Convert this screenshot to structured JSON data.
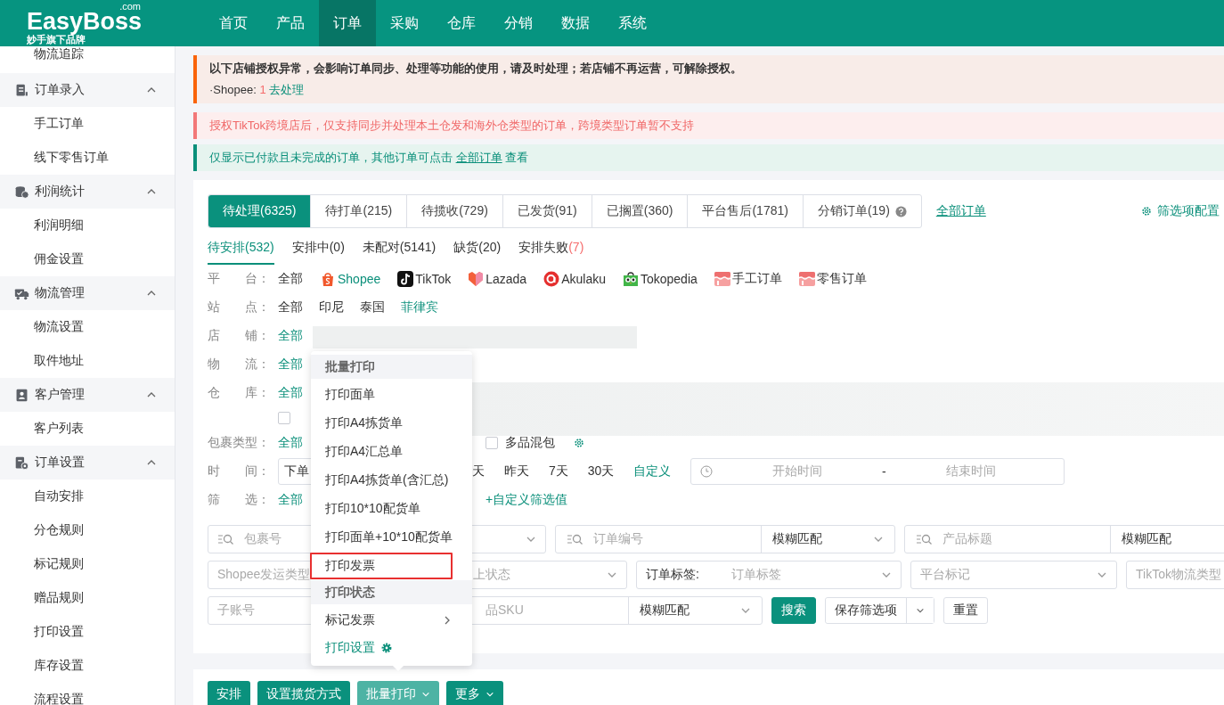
{
  "header": {
    "logo": {
      "name": "EasyBoss",
      "domain": ".com",
      "tagline": "妙手旗下品牌"
    },
    "nav": [
      {
        "label": "首页",
        "selected": false
      },
      {
        "label": "产品",
        "selected": false
      },
      {
        "label": "订单",
        "selected": true
      },
      {
        "label": "采购",
        "selected": false
      },
      {
        "label": "仓库",
        "selected": false
      },
      {
        "label": "分销",
        "selected": false
      },
      {
        "label": "数据",
        "selected": false
      },
      {
        "label": "系统",
        "selected": false
      }
    ]
  },
  "sidebar": {
    "items": [
      {
        "kind": "item",
        "label": "物流追踪"
      },
      {
        "kind": "group",
        "label": "订单录入",
        "expanded": true,
        "children": [
          {
            "label": "手工订单"
          },
          {
            "label": "线下零售订单"
          }
        ]
      },
      {
        "kind": "group",
        "label": "利润统计",
        "expanded": true,
        "children": [
          {
            "label": "利润明细"
          },
          {
            "label": "佣金设置"
          }
        ]
      },
      {
        "kind": "group",
        "label": "物流管理",
        "expanded": true,
        "children": [
          {
            "label": "物流设置"
          },
          {
            "label": "取件地址"
          }
        ]
      },
      {
        "kind": "group",
        "label": "客户管理",
        "expanded": true,
        "children": [
          {
            "label": "客户列表"
          }
        ]
      },
      {
        "kind": "group",
        "label": "订单设置",
        "expanded": true,
        "children": [
          {
            "label": "自动安排"
          },
          {
            "label": "分仓规则"
          },
          {
            "label": "标记规则"
          },
          {
            "label": "赠品规则"
          },
          {
            "label": "打印设置"
          },
          {
            "label": "库存设置"
          },
          {
            "label": "流程设置"
          }
        ]
      }
    ]
  },
  "alerts": [
    {
      "kind": "warning",
      "title": "以下店铺授权异常，会影响订单同步、处理等功能的使用，请及时处理；若店铺不再运营，可解除授权。",
      "platform": "·Shopee: ",
      "count": "1",
      "action": "去处理"
    },
    {
      "kind": "error",
      "text": "授权TikTok跨境店后，仅支持同步并处理本土仓发和海外仓类型的订单，跨境类型订单暂不支持"
    },
    {
      "kind": "info",
      "text": "仅显示已付款且未完成的订单，其他订单可点击 ",
      "link": "全部订单",
      "after": " 查看"
    }
  ],
  "tabs": [
    {
      "label": "待处理(6325)",
      "selected": true
    },
    {
      "label": "待打单(215)",
      "selected": false
    },
    {
      "label": "待揽收(729)",
      "selected": false
    },
    {
      "label": "已发货(91)",
      "selected": false
    },
    {
      "label": "已搁置(360)",
      "selected": false
    },
    {
      "label": "平台售后(1781)",
      "selected": false
    },
    {
      "label": "分销订单(19)",
      "selected": false,
      "help": true
    }
  ],
  "all_orders_link": "全部订单",
  "filter_config": "筛选项配置",
  "subtabs": [
    {
      "label": "待安排",
      "count": "(532)",
      "selected": true,
      "alert": false
    },
    {
      "label": "安排中",
      "count": "(0)",
      "selected": false,
      "alert": false
    },
    {
      "label": "未配对",
      "count": "(5141)",
      "selected": false,
      "alert": false
    },
    {
      "label": "缺货",
      "count": "(20)",
      "selected": false,
      "alert": false
    },
    {
      "label": "安排失败",
      "count": "(7)",
      "selected": false,
      "alert": true
    }
  ],
  "filters": [
    {
      "kind": "options",
      "label": "平　　台：",
      "options": [
        {
          "label": "全部",
          "selected": false
        },
        {
          "label": "Shopee",
          "selected": true,
          "kind": "shopee"
        },
        {
          "label": "TikTok",
          "selected": false,
          "kind": "tiktok"
        },
        {
          "label": "Lazada",
          "selected": false,
          "kind": "lazada"
        },
        {
          "label": "Akulaku",
          "selected": false,
          "kind": "akulaku"
        },
        {
          "label": "Tokopedia",
          "selected": false,
          "kind": "tokopedia"
        },
        {
          "label": "手工订单",
          "selected": false,
          "kind": "shop"
        },
        {
          "label": "零售订单",
          "selected": false,
          "kind": "shop"
        }
      ]
    },
    {
      "kind": "options",
      "label": "站　　点：",
      "options": [
        {
          "label": "全部",
          "selected": false
        },
        {
          "label": "印尼",
          "selected": false
        },
        {
          "label": "泰国",
          "selected": false
        },
        {
          "label": "菲律宾",
          "selected": true
        }
      ]
    },
    {
      "kind": "options",
      "label": "店　　铺：",
      "options": [
        {
          "label": "全部",
          "selected": true
        }
      ],
      "blurred": true
    },
    {
      "kind": "options",
      "label": "物　　流：",
      "options": [
        {
          "label": "全部",
          "selected": true
        }
      ]
    },
    {
      "kind": "options",
      "label": "仓　　库：",
      "options": [
        {
          "label": "全部",
          "selected": true
        }
      ],
      "blurred": true
    },
    {
      "kind": "checkbox",
      "checked": false
    },
    {
      "kind": "options",
      "label": "包裹类型：",
      "options": [
        {
          "label": "全部",
          "selected": true
        }
      ],
      "after": [
        {
          "kind": "checkbox",
          "label": "多品混包",
          "checked": false
        },
        {
          "kind": "gear"
        }
      ]
    },
    {
      "kind": "time",
      "label": "时　　间：",
      "select": "下单",
      "after": [
        {
          "kind": "option",
          "label": "天",
          "selected": false
        },
        {
          "kind": "option",
          "label": "昨天",
          "selected": false
        },
        {
          "kind": "option",
          "label": "7天",
          "selected": false
        },
        {
          "kind": "option",
          "label": "30天",
          "selected": false
        },
        {
          "kind": "option",
          "label": "自定义",
          "selected": true
        },
        {
          "kind": "range",
          "start": "开始时间",
          "separator": "-",
          "end": "结束时间"
        }
      ]
    },
    {
      "kind": "options",
      "label": "筛　　选：",
      "options": [
        {
          "label": "全部",
          "selected": true
        }
      ],
      "after": [
        {
          "kind": "link",
          "label": "+自定义筛选值"
        }
      ]
    }
  ],
  "search_rows": [
    [
      {
        "kind": "search",
        "placeholder": "包裹号"
      },
      {
        "kind": "select"
      },
      {
        "kind": "search",
        "placeholder": "订单编号",
        "match": "模糊匹配"
      },
      {
        "kind": "search",
        "placeholder": "产品标题",
        "match": "模糊匹配",
        "arrow": false
      }
    ],
    [
      {
        "kind": "select",
        "placeholder": "Shopee发运类型",
        "arrow": false
      },
      {
        "kind": "select",
        "placeholder": "上状态"
      },
      {
        "kind": "tagselect",
        "prefix": "订单标签:",
        "placeholder": "订单标签"
      },
      {
        "kind": "select",
        "placeholder": "平台标记"
      },
      {
        "kind": "select",
        "placeholder": "TikTok物流类型",
        "arrow": false
      }
    ],
    [
      {
        "kind": "input",
        "placeholder": "子账号"
      },
      {
        "kind": "input",
        "placeholder": "品SKU",
        "match": "模糊匹配"
      },
      {
        "kind": "primary",
        "label": "搜索"
      },
      {
        "kind": "split",
        "label": "保存筛选项"
      },
      {
        "kind": "plain",
        "label": "重置"
      }
    ]
  ],
  "menu": {
    "items": [
      {
        "kind": "header",
        "label": "批量打印"
      },
      {
        "kind": "item",
        "label": "打印面单",
        "outlined": false
      },
      {
        "kind": "item",
        "label": "打印A4拣货单",
        "outlined": false
      },
      {
        "kind": "item",
        "label": "打印A4汇总单",
        "outlined": false
      },
      {
        "kind": "item",
        "label": "打印A4拣货单(含汇总)",
        "outlined": false
      },
      {
        "kind": "item",
        "label": "打印10*10配货单",
        "outlined": false
      },
      {
        "kind": "item",
        "label": "打印面单+10*10配货单",
        "outlined": false
      },
      {
        "kind": "item",
        "label": "打印发票",
        "outlined": true
      },
      {
        "kind": "header",
        "label": "打印状态"
      },
      {
        "kind": "submenu",
        "label": "标记发票"
      },
      {
        "kind": "link",
        "label": "打印设置"
      }
    ]
  },
  "actions": [
    {
      "label": "安排",
      "dropdown": false,
      "open": false
    },
    {
      "label": "设置揽货方式",
      "dropdown": false,
      "open": false
    },
    {
      "label": "批量打印",
      "dropdown": true,
      "open": true
    },
    {
      "label": "更多",
      "dropdown": true,
      "open": false
    }
  ]
}
